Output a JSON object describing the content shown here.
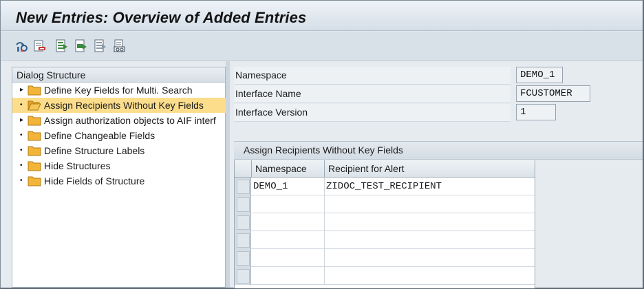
{
  "title": "New Entries: Overview of Added Entries",
  "toolbar": {
    "buttons": [
      {
        "icon": "change-display-icon"
      },
      {
        "icon": "delete-row-icon"
      },
      {
        "icon": "select-all-icon"
      },
      {
        "icon": "select-block-icon"
      },
      {
        "icon": "deselect-all-icon"
      },
      {
        "icon": "print-icon"
      }
    ]
  },
  "dialog_structure": {
    "header": "Dialog Structure",
    "items": [
      {
        "label": "Define Key Fields for Multi. Search",
        "marker": "▸",
        "selected": false
      },
      {
        "label": "Assign Recipients Without Key Fields",
        "marker": "•",
        "selected": true
      },
      {
        "label": "Assign authorization objects to AIF interf",
        "marker": "▸",
        "selected": false
      },
      {
        "label": "Define Changeable Fields",
        "marker": "•",
        "selected": false
      },
      {
        "label": "Define Structure Labels",
        "marker": "•",
        "selected": false
      },
      {
        "label": "Hide Structures",
        "marker": "•",
        "selected": false
      },
      {
        "label": "Hide Fields of Structure",
        "marker": "•",
        "selected": false
      }
    ]
  },
  "form": {
    "namespace": {
      "label": "Namespace",
      "value": "DEMO_1"
    },
    "interface_name": {
      "label": "Interface Name",
      "value": "FCUSTOMER"
    },
    "interface_version": {
      "label": "Interface Version",
      "value": "1"
    }
  },
  "table": {
    "title": "Assign Recipients Without Key Fields",
    "columns": [
      "Namespace",
      "Recipient for Alert"
    ],
    "rows": [
      [
        "DEMO_1",
        "ZIDOC_TEST_RECIPIENT"
      ],
      [
        "",
        ""
      ],
      [
        "",
        ""
      ],
      [
        "",
        ""
      ],
      [
        "",
        ""
      ],
      [
        "",
        ""
      ]
    ]
  },
  "colors": {
    "selected_row": "#fbdd8c",
    "folder": "#f2b53a",
    "background": "#dfe6ec"
  }
}
